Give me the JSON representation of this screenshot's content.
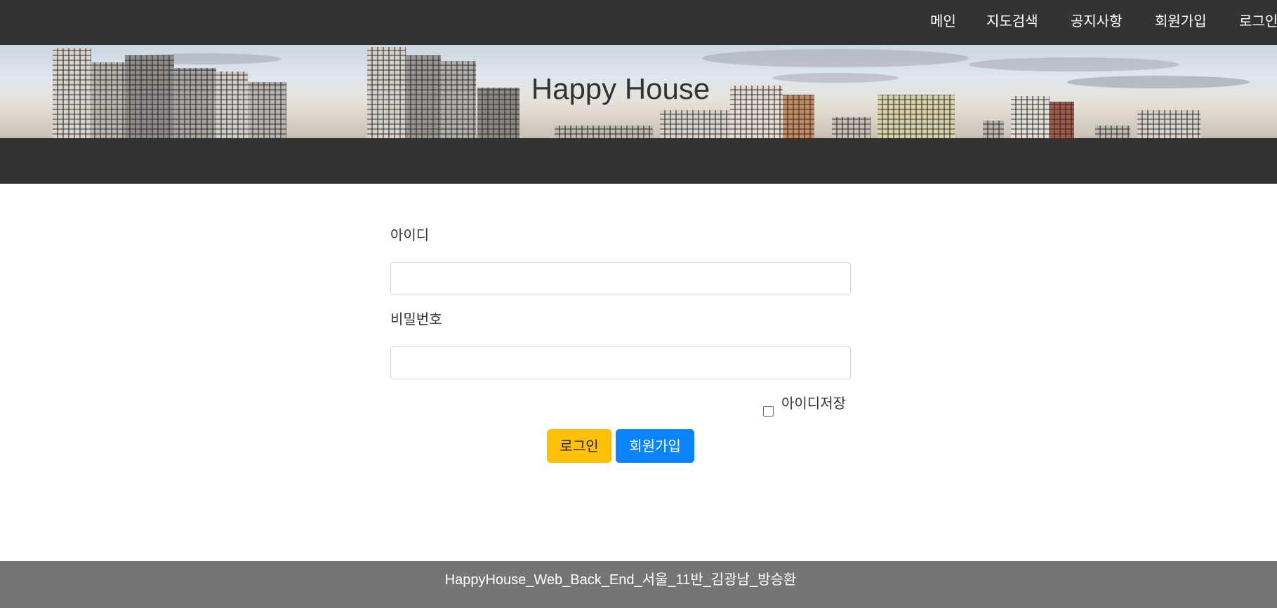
{
  "nav": {
    "items": [
      {
        "label": "메인"
      },
      {
        "label": "지도검색"
      },
      {
        "label": "공지사항"
      },
      {
        "label": "회원가입"
      },
      {
        "label": "로그인"
      }
    ]
  },
  "banner": {
    "title": "Happy House"
  },
  "login_form": {
    "id_label": "아이디",
    "id_value": "",
    "password_label": "비밀번호",
    "password_value": "",
    "remember_label": "아이디저장",
    "remember_checked": false,
    "login_button": "로그인",
    "join_button": "회원가입"
  },
  "footer": {
    "text": "HappyHouse_Web_Back_End_서울_11반_김광남_방승환"
  },
  "colors": {
    "nav_bg": "#333333",
    "login_button": "#ffc107",
    "join_button": "#0d84ff",
    "footer_bg": "#757575"
  }
}
